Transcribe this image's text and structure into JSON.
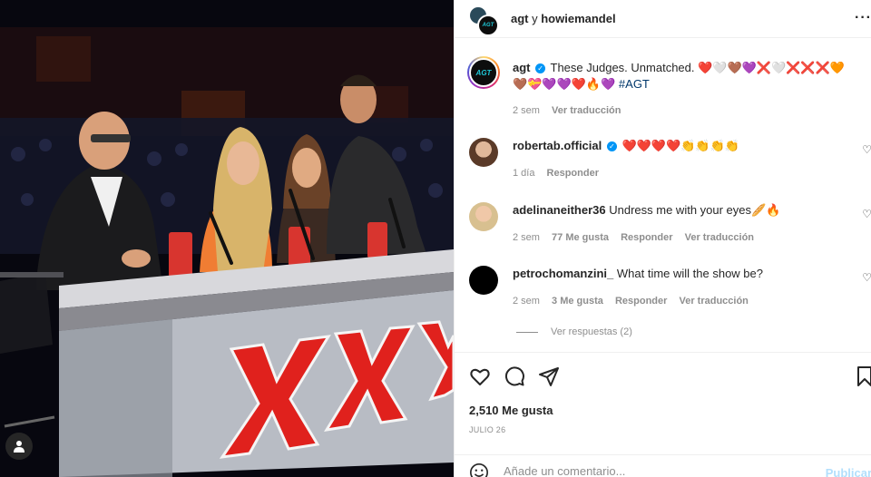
{
  "post": {
    "header_user": "agt",
    "header_conj": " y ",
    "header_collab": "howiemandel"
  },
  "caption": {
    "user": "agt",
    "text": "These Judges. Unmatched. ❤️🤍🤎💜❌🤍❌❌❌🧡",
    "text2": "🤎💝💜💜❤️🔥💜 ",
    "hashtag": "#AGT",
    "time": "2 sem",
    "translate": "Ver traducción"
  },
  "comments": [
    {
      "user": "robertab.official",
      "verified": true,
      "text": "❤️❤️❤️❤️👏👏👏👏",
      "time": "1 día",
      "likes": "",
      "reply": "Responder",
      "translate": ""
    },
    {
      "user": "adelinaneither36",
      "verified": false,
      "text": "Undress me with your eyes🥖🔥",
      "time": "2 sem",
      "likes": "77 Me gusta",
      "reply": "Responder",
      "translate": "Ver traducción"
    },
    {
      "user": "petrochomanzini_",
      "verified": false,
      "text": "What time will the show be?",
      "time": "2 sem",
      "likes": "3 Me gusta",
      "reply": "Responder",
      "translate": "Ver traducción"
    }
  ],
  "view_replies": "Ver respuestas (2)",
  "likes_count": "2,510 Me gusta",
  "date": "JULIO 26",
  "comment_input": {
    "placeholder": "Añade un comentario..."
  },
  "publish_label": "Publicar",
  "icons": {
    "like": "heart-icon",
    "comment": "comment-icon",
    "share": "send-icon",
    "save": "bookmark-icon",
    "more": "more-icon",
    "emoji": "emoji-icon",
    "tag": "user-tag-icon"
  },
  "colors": {
    "accent": "#0095f6",
    "publish_disabled": "#b2dffc",
    "meta": "#8e8e8e",
    "hashtag": "#00376b"
  }
}
